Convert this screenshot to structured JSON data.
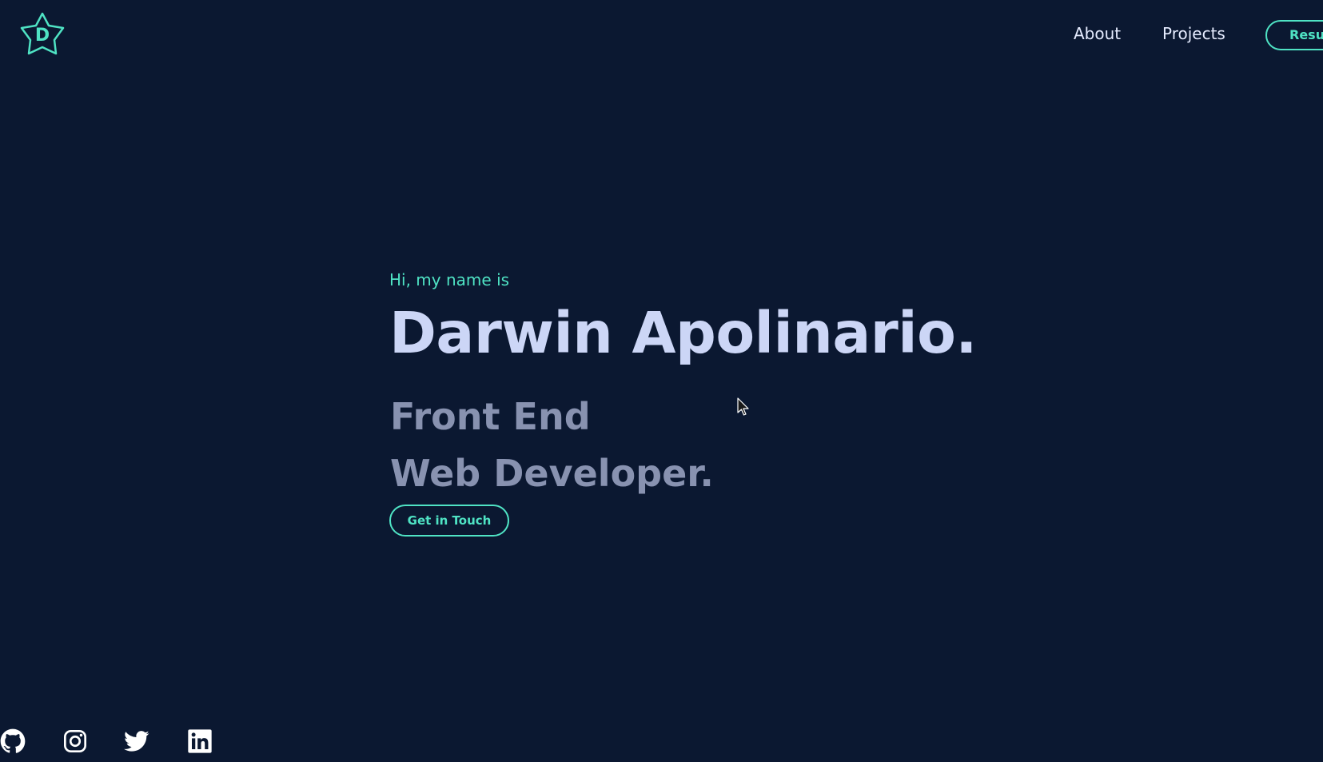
{
  "header": {
    "logo_letter": "D",
    "logo_icon": "star-logo-icon",
    "nav": [
      {
        "label": "About"
      },
      {
        "label": "Projects"
      }
    ],
    "resume_label": "Resume"
  },
  "hero": {
    "intro": "Hi, my name is",
    "name": "Darwin Apolinario.",
    "role_line_1": "Front End",
    "role_line_2": "Web Developer.",
    "cta_label": "Get in Touch"
  },
  "social_links": [
    {
      "icon": "github-icon"
    },
    {
      "icon": "instagram-icon"
    },
    {
      "icon": "twitter-icon"
    },
    {
      "icon": "linkedin-icon"
    }
  ],
  "colors": {
    "background": "#0b1831",
    "accent": "#4fe3c4",
    "heading": "#ccd6f6",
    "subheading": "#8892b0",
    "nav_text": "#e6ecff"
  }
}
